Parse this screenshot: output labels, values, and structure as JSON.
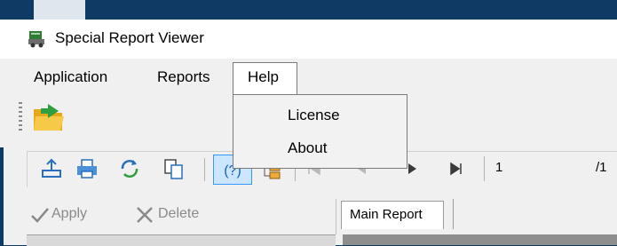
{
  "window": {
    "title": "Special Report Viewer"
  },
  "menubar": {
    "items": [
      "Application",
      "Reports",
      "Help"
    ]
  },
  "help_menu": {
    "items": [
      "License",
      "About"
    ]
  },
  "toolbar": {
    "page_value": "1",
    "page_total": "/1"
  },
  "actions": {
    "apply": "Apply",
    "delete": "Delete"
  },
  "tabs": {
    "main": "Main Report"
  },
  "icons": {
    "app": "report-viewer-icon",
    "open": "open-folder-icon",
    "export": "export-icon",
    "print": "print-icon",
    "refresh": "refresh-icon",
    "copy": "copy-pages-icon",
    "help": "help-icon",
    "layout": "tree-layout-icon",
    "first": "first-page-icon",
    "prev": "prev-page-icon",
    "next": "next-page-icon",
    "last": "last-page-icon"
  }
}
